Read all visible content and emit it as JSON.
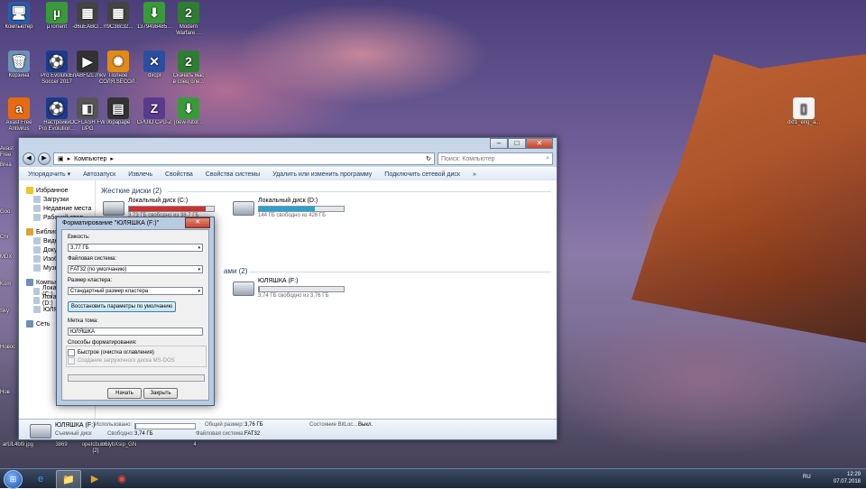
{
  "desktop": {
    "icons": [
      {
        "label": "Компьютер",
        "glyph": "🖥",
        "color": "#2a5caa"
      },
      {
        "label": "µTorrent",
        "glyph": "µ",
        "color": "#3a9a3a"
      },
      {
        "label": "-d6uEABO...",
        "glyph": "▦",
        "color": "#444"
      },
      {
        "label": "rr9C38c32...",
        "glyph": "▦",
        "color": "#444"
      },
      {
        "label": "1379498485...",
        "glyph": "⬇",
        "color": "#3a9a3a"
      },
      {
        "label": "Modern\nWarfare ...",
        "glyph": "2",
        "color": "#2e7d32"
      },
      {
        "label": "Корзина",
        "glyph": "🗑",
        "color": "#6d8fb8"
      },
      {
        "label": "Pro Evolution\nSoccer 2017",
        "glyph": "⚽",
        "color": "#1b3b8c"
      },
      {
        "label": "EnABFtZL.mkv",
        "glyph": "▶",
        "color": "#333"
      },
      {
        "label": "Полное\nСОЛЯ.SEСОЛ...",
        "glyph": "✺",
        "color": "#e08a18"
      },
      {
        "label": "dxcpl",
        "glyph": "✕",
        "color": "#2b4fa0"
      },
      {
        "label": "Скачать мас\nв спец оле...",
        "glyph": "2",
        "color": "#2e7d32"
      },
      {
        "label": "Avast Free\nAntivirus",
        "glyph": "a",
        "color": "#e86a10"
      },
      {
        "label": "Настройки\nPro Evolution...",
        "glyph": "⚽",
        "color": "#1b3b8c"
      },
      {
        "label": "OCFLASH FW\nUPG",
        "glyph": "◧",
        "color": "#555"
      },
      {
        "label": "0брарарe",
        "glyph": "▤",
        "color": "#333"
      },
      {
        "label": "CPUID CPU-Z",
        "glyph": "Z",
        "color": "#5a3a8c"
      },
      {
        "label": "[new-rutor...",
        "glyph": "⬇",
        "color": "#3a9a3a"
      },
      {
        "label": "dxf1_eng_a...",
        "glyph": "▯",
        "color": "#f5f5f5"
      }
    ],
    "left_partial_labels": [
      "Avast Free",
      "Brea",
      "Goo",
      "Chr",
      "MDX",
      "Kom",
      "Sky",
      "Новос",
      "Нов",
      "arUL4bl9.jpg",
      "3869",
      "opeIcbubliu\n(2)",
      "n6lybXsip_GN",
      "4"
    ]
  },
  "explorer": {
    "window_title": "",
    "controls": {
      "minimize": "–",
      "maximize": "□",
      "close": "✕"
    },
    "address": {
      "back": "◀",
      "forward": "▶",
      "path_icon": "▣",
      "path_sep": "▸",
      "path": "Компьютер",
      "path_end": "▸",
      "refresh": "↻"
    },
    "search": {
      "placeholder": "Поиск: Компьютер",
      "icon": "⌕"
    },
    "toolbar": [
      "Упорядочить ▾",
      "Автозапуск",
      "Извлечь",
      "Свойства",
      "Свойства системы",
      "Удалить или изменить программу",
      "Подключить сетевой диск",
      "»"
    ],
    "sidebar": {
      "groups": [
        {
          "head": "Избранное",
          "icon_color": "#f2c232",
          "items": [
            "Загрузки",
            "Недавние места",
            "Рабочий стол"
          ]
        },
        {
          "head": "Библиотеки",
          "icon_color": "#d9a43a",
          "items": [
            "Видео",
            "Документы",
            "Изображения",
            "Музыка"
          ]
        },
        {
          "head": "Компьютер",
          "icon_color": "#6d8fb8",
          "items": [
            "Локальный диск (C:)",
            "Локальный диск (D:)",
            "ЮЛЯШКА (F:)"
          ]
        },
        {
          "head": "Сеть",
          "icon_color": "#6d8fb8",
          "items": []
        }
      ]
    },
    "group_hard": "Жесткие диски (2)",
    "group_removable_suffix": "ами (2)",
    "drives": [
      {
        "name": "Локальный диск (C:)",
        "free": "3,73 ГБ свободно из 38,7 ГБ",
        "fill": 0.9,
        "color": "#d9302c"
      },
      {
        "name": "Локальный диск (D:)",
        "free": "144 ГБ свободно из 426 ГБ",
        "fill": 0.66,
        "color": "#2aa2cf"
      },
      {
        "name": "ЮЛЯШКА (F:)",
        "free": "3,74 ГБ свободно из 3,76 ГБ",
        "fill": 0.01,
        "color": "#2aa2cf"
      }
    ],
    "details": {
      "name": "ЮЛЯШКА (F:)",
      "type": "Съемный диск",
      "used_label": "Использовано:",
      "used_fill": 0.01,
      "free_label": "Свободно:",
      "free_value": "3,74 ГБ",
      "total_label": "Общий размер:",
      "total_value": "3,76 ГБ",
      "fs_label": "Файловая система:",
      "fs_value": "FAT32",
      "bitlocker_label": "Состояние BitLoc...",
      "bitlocker_value": "Выкл."
    }
  },
  "format_dialog": {
    "title": "Форматирование \"ЮЛЯШКА (F:)\"",
    "close": "✕",
    "capacity_label": "Емкость:",
    "capacity_value": "3,77 ГБ",
    "fs_label": "Файловая система:",
    "fs_value": "FAT32 (по умолчанию)",
    "cluster_label": "Размер кластера:",
    "cluster_value": "Стандартный размер кластера",
    "restore_button": "Восстановить параметры по умолчанию",
    "volume_label": "Метка тома:",
    "volume_value": "ЮЛЯШКА",
    "options_label": "Способы форматирования:",
    "quick_format": "Быстрое (очистка оглавления)",
    "msdos_disk": "Создание загрузочного диска MS-DOS",
    "progress": 0,
    "start_button": "Начать",
    "close_button": "Закрыть",
    "arrow": "▾"
  },
  "taskbar": {
    "start": "⊞",
    "apps": [
      {
        "name": "ie",
        "glyph": "e",
        "color": "#3b9ae8",
        "active": false
      },
      {
        "name": "explorer",
        "glyph": "📁",
        "color": "#f0c040",
        "active": true
      },
      {
        "name": "media",
        "glyph": "▶",
        "color": "#e8a030",
        "active": false
      },
      {
        "name": "chrome",
        "glyph": "◉",
        "color": "#e84a3a",
        "active": false
      }
    ],
    "lang": "RU",
    "time": "12:29",
    "date": "07.07.2018"
  }
}
